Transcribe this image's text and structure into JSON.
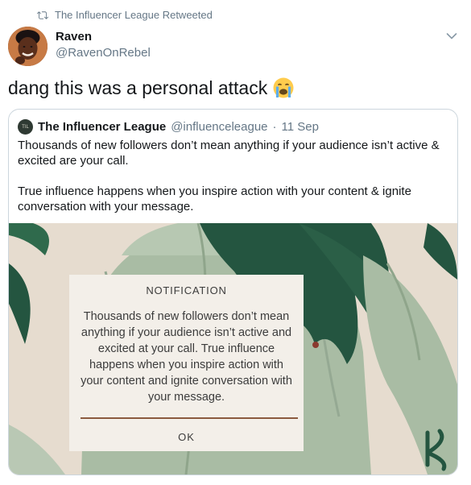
{
  "retweet": {
    "text": "The Influencer League Retweeted"
  },
  "tweet": {
    "author_name": "Raven",
    "author_handle": "@RavenOnRebel",
    "text": "dang this was a personal attack",
    "emoji": "loudly-crying-face"
  },
  "quoted": {
    "logo_text": "TIL",
    "author_name": "The Influencer League",
    "author_handle": "@influenceleague",
    "separator": "·",
    "date": "11 Sep",
    "paragraph1": "Thousands of new followers don’t mean anything if your audience isn’t active & excited are your call.",
    "paragraph2": "True influence happens when you inspire action with your content & ignite conversation with your message."
  },
  "image": {
    "notification_title": "NOTIFICATION",
    "notification_message": "Thousands of new followers don’t mean anything if your audience isn’t active and excited at your call. True influence happens when you inspire action with your content and ignite conversation with your message.",
    "ok_label": "OK"
  },
  "colors": {
    "muted_text": "#657786",
    "card_border": "#ccd6dd",
    "image_background": "#e6dccf",
    "leaf_dark": "#245540",
    "sweater_green": "#a9bca4",
    "notification_bg": "#f3efe9",
    "notification_rule": "#8b5a3f"
  }
}
